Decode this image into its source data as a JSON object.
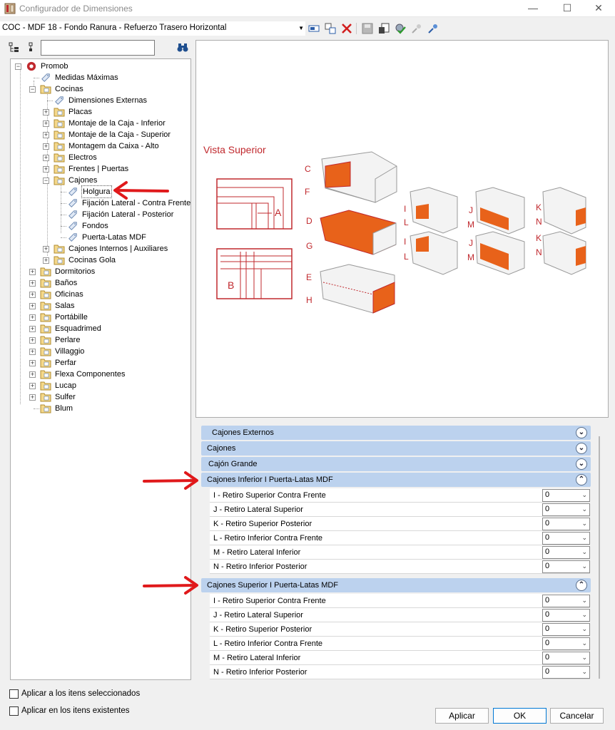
{
  "window": {
    "title": "Configurador de Dimensiones"
  },
  "toolbar": {
    "combo_value": "COC - MDF 18 - Fondo Ranura - Refuerzo Trasero Horizontal"
  },
  "tree": {
    "items": [
      {
        "label": "Promob"
      },
      {
        "label": "Medidas Máximas"
      },
      {
        "label": "Cocinas"
      },
      {
        "label": "Dimensiones Externas"
      },
      {
        "label": "Placas"
      },
      {
        "label": "Montaje de la Caja - Inferior"
      },
      {
        "label": "Montaje de la Caja - Superior"
      },
      {
        "label": "Montagem da Caixa - Alto"
      },
      {
        "label": "Electros"
      },
      {
        "label": "Frentes | Puertas"
      },
      {
        "label": "Cajones"
      },
      {
        "label": "Holgura"
      },
      {
        "label": "Fijación Lateral - Contra Frente"
      },
      {
        "label": "Fijación Lateral - Posterior"
      },
      {
        "label": "Fondos"
      },
      {
        "label": "Puerta-Latas MDF"
      },
      {
        "label": "Cajones Internos | Auxiliares"
      },
      {
        "label": "Cocinas Gola"
      },
      {
        "label": "Dormitorios"
      },
      {
        "label": "Baños"
      },
      {
        "label": "Oficinas"
      },
      {
        "label": "Salas"
      },
      {
        "label": "Portábille"
      },
      {
        "label": "Esquadrimed"
      },
      {
        "label": "Perlare"
      },
      {
        "label": "Villaggio"
      },
      {
        "label": "Perfar"
      },
      {
        "label": "Flexa Componentes"
      },
      {
        "label": "Lucap"
      },
      {
        "label": "Sulfer"
      },
      {
        "label": "Blum"
      }
    ]
  },
  "preview": {
    "title": "Vista Superior",
    "labels": [
      "A",
      "B",
      "C",
      "F",
      "D",
      "G",
      "E",
      "H",
      "I",
      "L",
      "I",
      "L",
      "J",
      "M",
      "J",
      "M",
      "K",
      "N",
      "K",
      "N"
    ]
  },
  "groups": {
    "g1": {
      "title": "Cajones Externos"
    },
    "g2": {
      "title": "Cajones"
    },
    "g3": {
      "title": "Cajón Grande"
    },
    "g4": {
      "title": "Cajones Inferior I Puerta-Latas MDF",
      "rows": [
        {
          "label": "I - Retiro Superior Contra Frente",
          "value": "0"
        },
        {
          "label": "J - Retiro Lateral Superior",
          "value": "0"
        },
        {
          "label": "K - Retiro Superior Posterior",
          "value": "0"
        },
        {
          "label": "L - Retiro Inferior Contra Frente",
          "value": "0"
        },
        {
          "label": "M - Retiro Lateral Inferior",
          "value": "0"
        },
        {
          "label": "N - Retiro Inferior Posterior",
          "value": "0"
        }
      ]
    },
    "g5": {
      "title": "Cajones Superior I Puerta-Latas MDF",
      "rows": [
        {
          "label": "I - Retiro Superior Contra Frente",
          "value": "0"
        },
        {
          "label": "J - Retiro Lateral Superior",
          "value": "0"
        },
        {
          "label": "K - Retiro Superior Posterior",
          "value": "0"
        },
        {
          "label": "L - Retiro Inferior Contra Frente",
          "value": "0"
        },
        {
          "label": "M - Retiro Lateral Inferior",
          "value": "0"
        },
        {
          "label": "N - Retiro Inferior Posterior",
          "value": "0"
        }
      ]
    }
  },
  "footer": {
    "apply_selected": "Aplicar a los itens seleccionados",
    "apply_existing": "Aplicar en los itens existentes",
    "apply_btn": "Aplicar",
    "ok_btn": "OK",
    "cancel_btn": "Cancelar"
  },
  "colors": {
    "accent_orange": "#e8621a",
    "drawing_red": "#c0282d",
    "group_header": "#bcd2ee",
    "annotation_red": "#e0191b"
  }
}
